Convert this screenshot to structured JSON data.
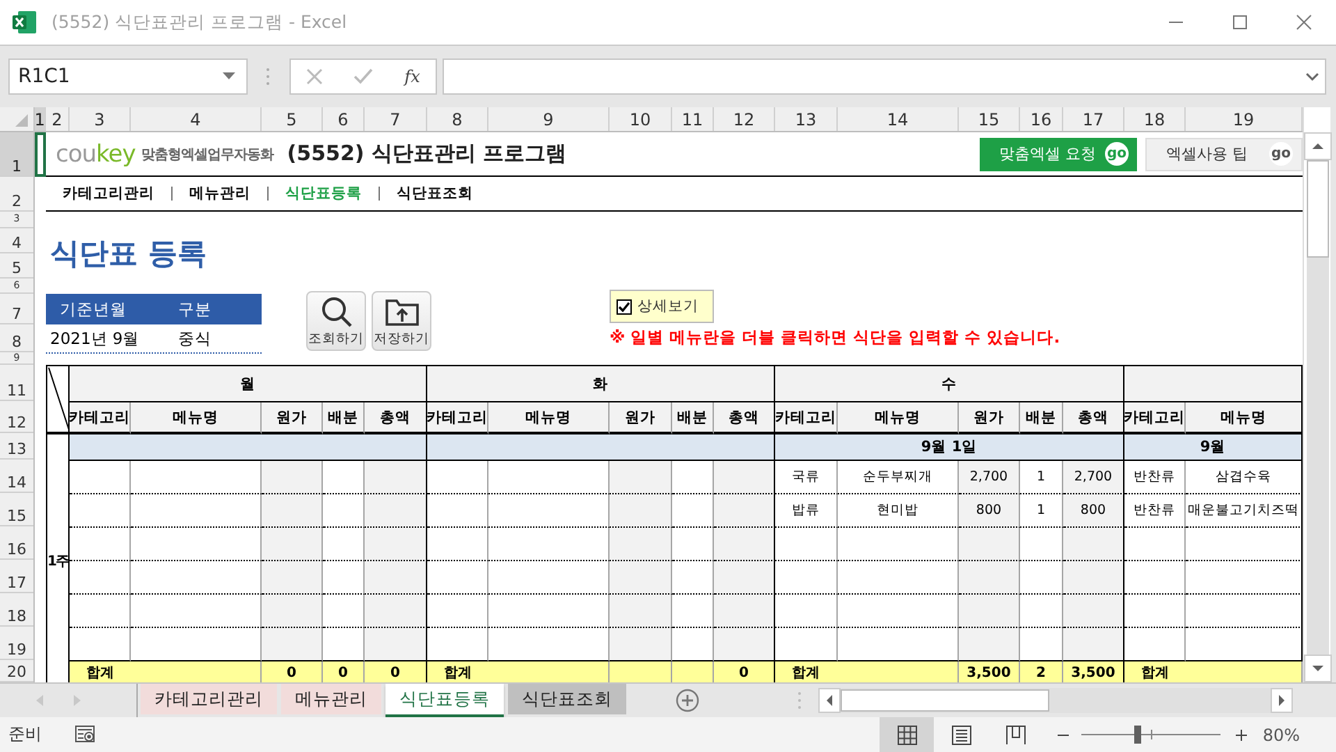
{
  "window": {
    "title": "(5552) 식단표관리 프로그램 - Excel"
  },
  "formula_bar": {
    "name_box": "R1C1",
    "fx": "fx"
  },
  "column_headers": [
    "1",
    "2",
    "3",
    "4",
    "5",
    "6",
    "7",
    "8",
    "9",
    "10",
    "11",
    "12",
    "13",
    "14",
    "15",
    "16",
    "17",
    "18",
    "19"
  ],
  "row_headers": [
    "1",
    "2",
    "3",
    "4",
    "5",
    "6",
    "7",
    "8",
    "9",
    "11",
    "12",
    "13",
    "14",
    "15",
    "16",
    "17",
    "18",
    "19",
    "20"
  ],
  "header": {
    "logo": [
      "cou",
      "key"
    ],
    "tagline": "맞춤형엑셀업무자동화",
    "title": "(5552) 식단표관리 프로그램",
    "links": [
      {
        "label": "맞춤엑셀 요청",
        "go": "go",
        "kind": "primary"
      },
      {
        "label": "엑셀사용 팁",
        "go": "go",
        "kind": "secondary"
      }
    ]
  },
  "nav": [
    {
      "label": "카테고리관리",
      "selected": false
    },
    {
      "label": "메뉴관리",
      "selected": false
    },
    {
      "label": "식단표등록",
      "selected": true
    },
    {
      "label": "식단표조회",
      "selected": false
    }
  ],
  "page_title": "식단표 등록",
  "filters": {
    "columns": [
      "기준년월",
      "구분"
    ],
    "values": [
      "2021년 9월",
      "중식"
    ]
  },
  "actions": [
    {
      "label": "조회하기",
      "kind": "search"
    },
    {
      "label": "저장하기",
      "kind": "save"
    }
  ],
  "detail_view": {
    "label": "상세보기",
    "checked": true
  },
  "notice": "※ 일별 메뉴란을 더블 클릭하면 식단을 입력할 수 있습니다.",
  "table": {
    "week": "1주",
    "days": [
      {
        "name": "월",
        "columns": [
          "카테고리",
          "메뉴명",
          "원가",
          "배분",
          "총액"
        ],
        "totals": {
          "label": "합계",
          "cost": "0",
          "portion": "0",
          "total": "0"
        }
      },
      {
        "name": "화",
        "columns": [
          "카테고리",
          "메뉴명",
          "원가",
          "배분",
          "총액"
        ],
        "totals": {
          "label": "합계",
          "total": "0"
        }
      },
      {
        "name": "수",
        "columns": [
          "카테고리",
          "메뉴명",
          "원가",
          "배분",
          "총액"
        ],
        "date": "9월 1일",
        "entries": [
          {
            "category": "국류",
            "menu": "순두부찌개",
            "cost": "2,700",
            "portion": "1",
            "total": "2,700"
          },
          {
            "category": "밥류",
            "menu": "현미밥",
            "cost": "800",
            "portion": "1",
            "total": "800"
          }
        ],
        "totals": {
          "label": "합계",
          "cost": "3,500",
          "portion": "2",
          "total": "3,500"
        }
      },
      {
        "columns": [
          "카테고리",
          "메뉴명"
        ],
        "date": "9월",
        "entries": [
          {
            "category": "반찬류",
            "menu": "삼겹수육"
          },
          {
            "category": "반찬류",
            "menu": "매운불고기치즈떡"
          }
        ],
        "totals": {
          "label": "합계"
        }
      }
    ]
  },
  "sheet_tabs": [
    {
      "label": "카테고리관리",
      "color": "#f2dcdb",
      "selected": false
    },
    {
      "label": "메뉴관리",
      "color": "#f2dcdb",
      "selected": false
    },
    {
      "label": "식단표등록",
      "color": "#ffffff",
      "selected": true
    },
    {
      "label": "식단표조회",
      "color": "#bfbfbf",
      "selected": false
    }
  ],
  "status_bar": {
    "status": "준비",
    "views": [
      {
        "kind": "normal",
        "selected": true
      },
      {
        "kind": "page_layout",
        "selected": false
      },
      {
        "kind": "page_break",
        "selected": false
      }
    ],
    "zoom": {
      "level": 0.4,
      "reading": "80%"
    }
  }
}
